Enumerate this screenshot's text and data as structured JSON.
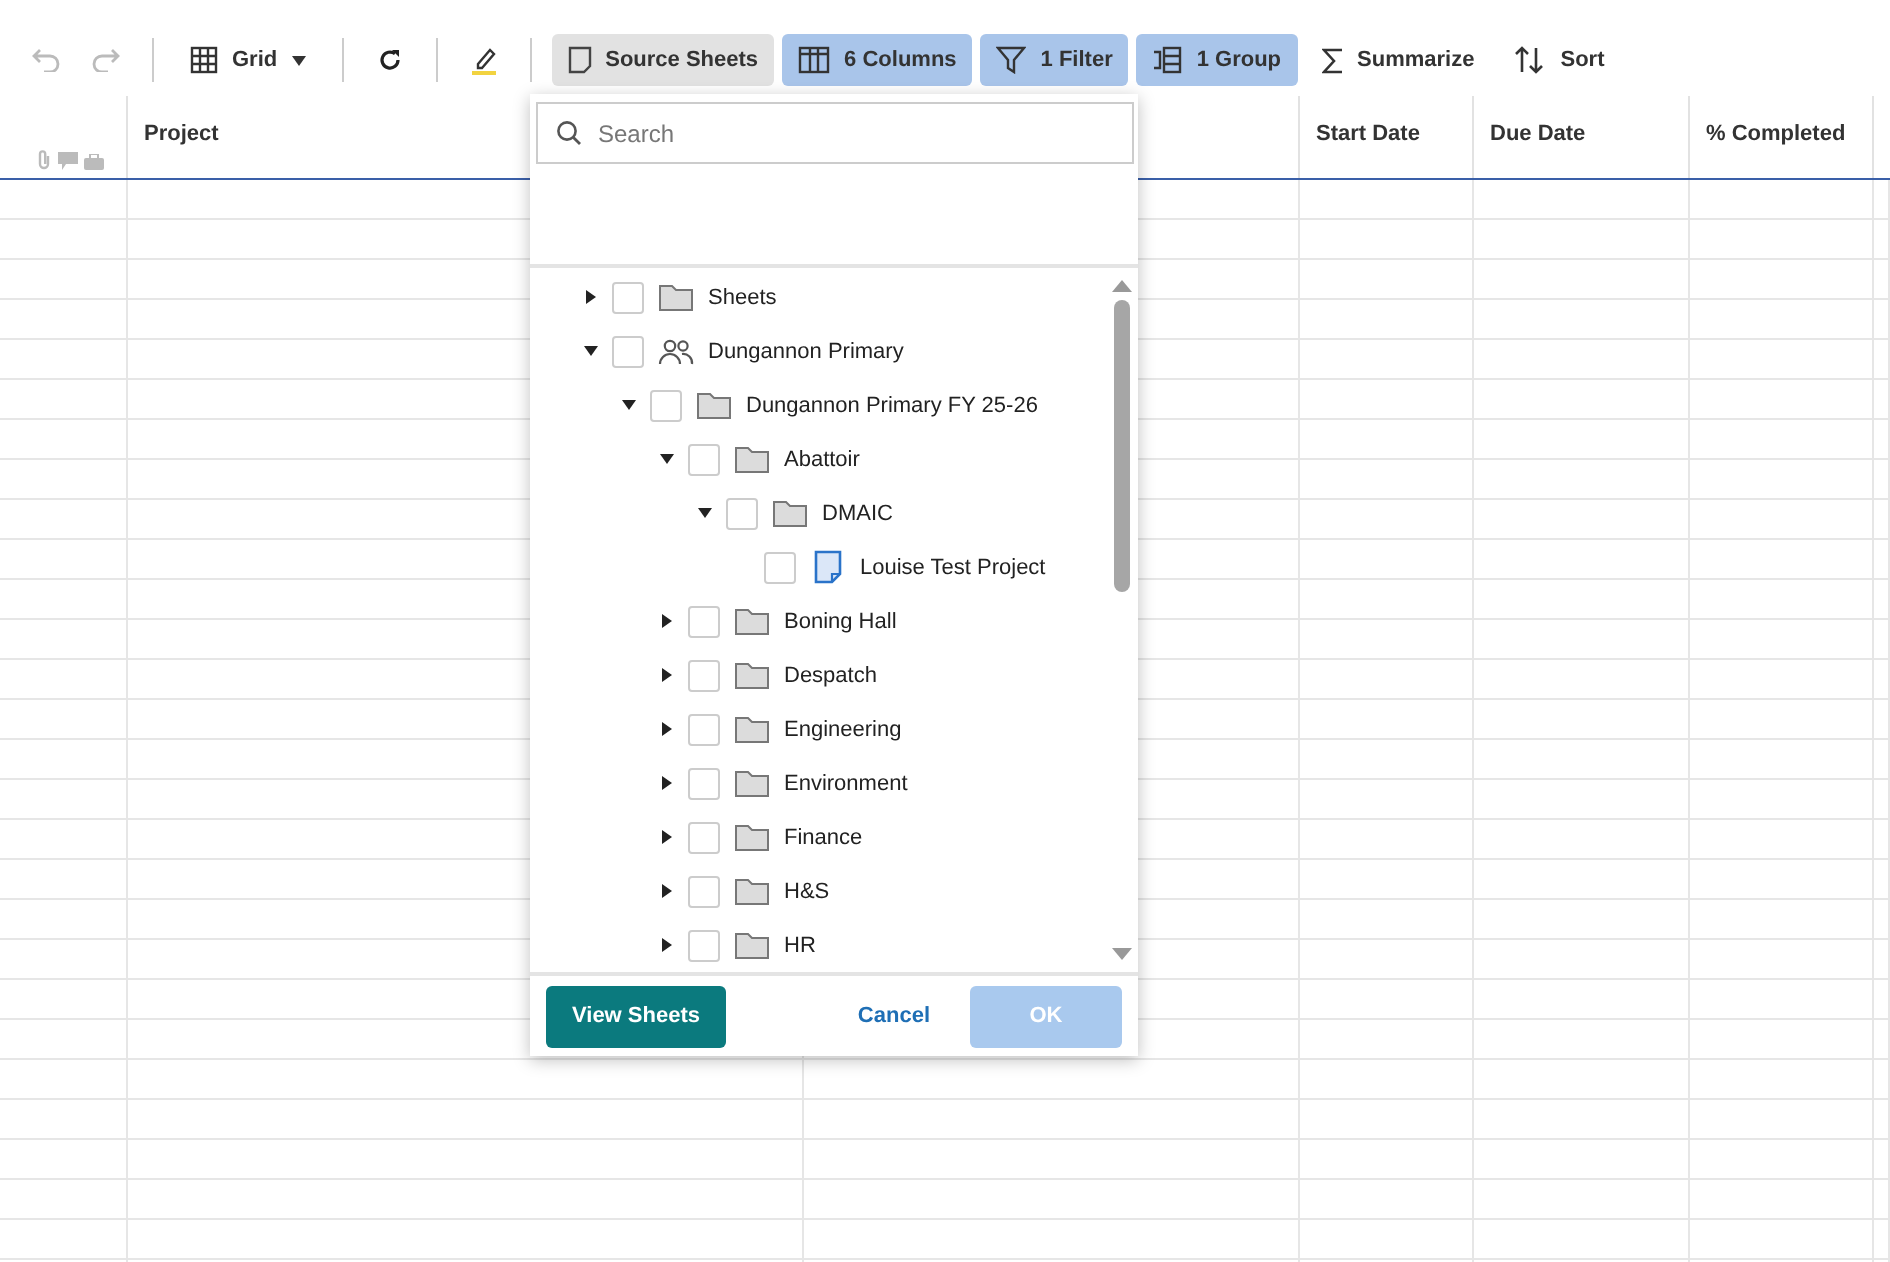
{
  "toolbar": {
    "items": [
      {
        "kind": "undo",
        "disabled": true
      },
      {
        "kind": "redo",
        "disabled": true
      },
      {
        "kind": "grid",
        "label": "Grid"
      },
      {
        "kind": "refresh"
      },
      {
        "kind": "highlight"
      },
      {
        "kind": "source",
        "label": "Source Sheets",
        "open": true,
        "highlighted": false
      },
      {
        "kind": "columns",
        "label": "6 Columns",
        "open": false,
        "highlighted": true
      },
      {
        "kind": "filter",
        "label": "1 Filter",
        "open": false,
        "highlighted": true
      },
      {
        "kind": "group",
        "label": "1 Group",
        "open": false,
        "highlighted": true
      },
      {
        "kind": "summarize",
        "label": "Summarize",
        "open": false,
        "highlighted": false
      },
      {
        "kind": "sort",
        "label": "Sort",
        "open": false,
        "highlighted": false
      }
    ]
  },
  "grid": {
    "columns": [
      "Project",
      "Start Date",
      "Due Date",
      "% Completed"
    ]
  },
  "source_sheets": {
    "search": {
      "placeholder": "Search"
    },
    "tree": [
      {
        "kind": "folder",
        "label": "Sheets",
        "expanded": false,
        "checked": false
      },
      {
        "kind": "workspace",
        "label": "Dungannon Primary",
        "expanded": true,
        "checked": false,
        "children": [
          {
            "kind": "folder",
            "label": "Dungannon Primary FY 25-26",
            "expanded": true,
            "checked": false,
            "children": [
              {
                "kind": "folder",
                "label": "Abattoir",
                "expanded": true,
                "checked": false,
                "children": [
                  {
                    "kind": "folder",
                    "label": "DMAIC",
                    "expanded": true,
                    "checked": false,
                    "children": [
                      {
                        "kind": "sheet",
                        "label": "Louise Test Project",
                        "checked": false
                      }
                    ]
                  }
                ]
              },
              {
                "kind": "folder",
                "label": "Boning Hall",
                "expanded": false,
                "checked": false
              },
              {
                "kind": "folder",
                "label": "Despatch",
                "expanded": false,
                "checked": false
              },
              {
                "kind": "folder",
                "label": "Engineering",
                "expanded": false,
                "checked": false
              },
              {
                "kind": "folder",
                "label": "Environment",
                "expanded": false,
                "checked": false
              },
              {
                "kind": "folder",
                "label": "Finance",
                "expanded": false,
                "checked": false
              },
              {
                "kind": "folder",
                "label": "H&S",
                "expanded": false,
                "checked": false
              },
              {
                "kind": "folder",
                "label": "HR",
                "expanded": false,
                "checked": false
              }
            ]
          }
        ]
      }
    ],
    "buttons": {
      "view_sheets": "View Sheets",
      "cancel": "Cancel",
      "ok": "OK",
      "ok_disabled": true
    }
  }
}
